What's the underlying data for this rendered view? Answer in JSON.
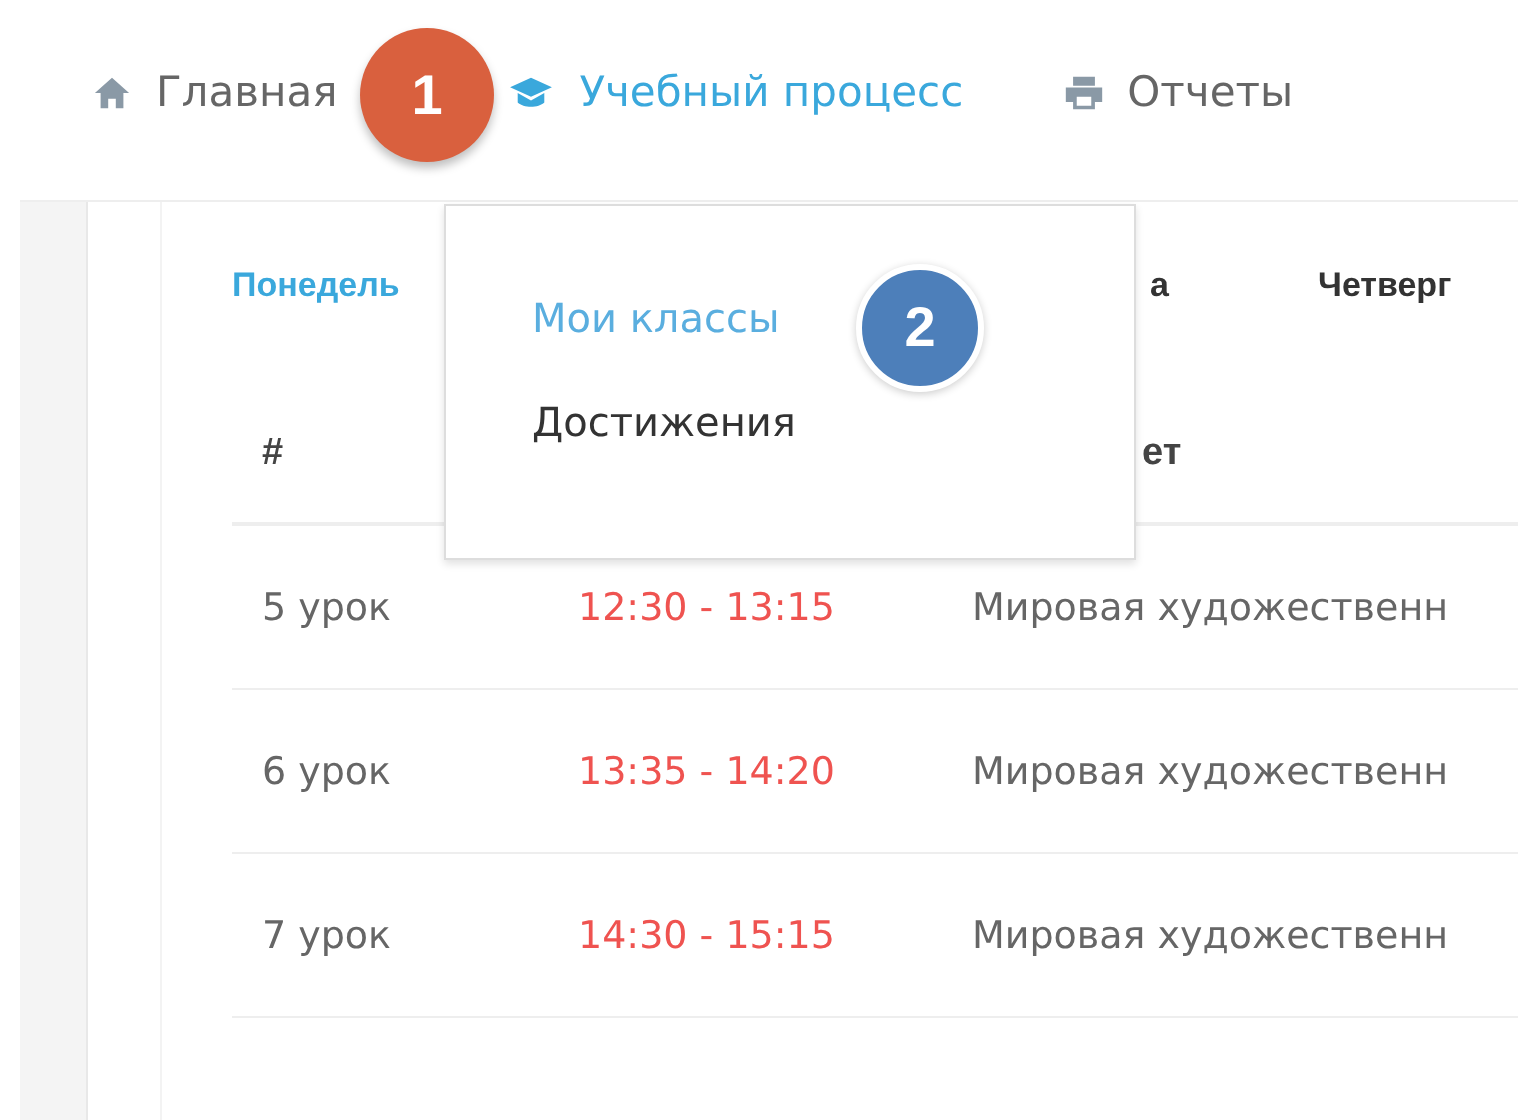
{
  "nav": [
    {
      "label": "Главная",
      "selected": false
    },
    {
      "label": "Учебный процесс",
      "selected": true
    },
    {
      "label": "Отчеты",
      "selected": false
    }
  ],
  "dropdown": {
    "items": [
      {
        "label": "Мои классы",
        "selected": true
      },
      {
        "label": "Достижения",
        "selected": false
      }
    ]
  },
  "callouts": [
    "1",
    "2"
  ],
  "days": [
    {
      "label": "Понедель",
      "selected": true
    },
    {
      "label": "а",
      "selected": false
    },
    {
      "label": "Четверг",
      "selected": false
    }
  ],
  "table": {
    "columns": [
      "#",
      "ет"
    ],
    "rows": [
      {
        "lesson": "5 урок",
        "time": "12:30 - 13:15",
        "subject": "Мировая художественн"
      },
      {
        "lesson": "6 урок",
        "time": "13:35 - 14:20",
        "subject": "Мировая художественн"
      },
      {
        "lesson": "7 урок",
        "time": "14:30 - 15:15",
        "subject": "Мировая художественн"
      }
    ]
  }
}
